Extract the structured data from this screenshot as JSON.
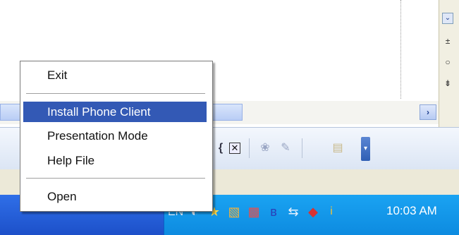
{
  "context_menu": {
    "items": [
      {
        "label": "Exit"
      },
      {
        "label": "Install Phone Client",
        "highlighted": true
      },
      {
        "label": "Presentation Mode"
      },
      {
        "label": "Help File"
      },
      {
        "label": "Open"
      }
    ]
  },
  "side_panel": {
    "icons": [
      "chevron-down-icon",
      "plus-icon",
      "circle-icon",
      "arrow-icon"
    ]
  },
  "scrollbar": {
    "right_arrow": "›"
  },
  "toolbar": {
    "icons": [
      "curly-brace-icon",
      "close-box-icon",
      "paint-icon",
      "pencil-icon",
      "folder-icon",
      "toolbar-overflow-icon"
    ]
  },
  "taskbar": {
    "language": "EN",
    "clock": "10:03 AM",
    "tray_icons": [
      "network-icon",
      "star-icon",
      "palette-icon",
      "flag-icon",
      "bluetooth-icon",
      "usb-icon",
      "audio-icon",
      "info-icon"
    ]
  },
  "colors": {
    "menu_highlight": "#3359b5",
    "taskbar": "#1d50c9",
    "tray": "#0d8be0"
  }
}
